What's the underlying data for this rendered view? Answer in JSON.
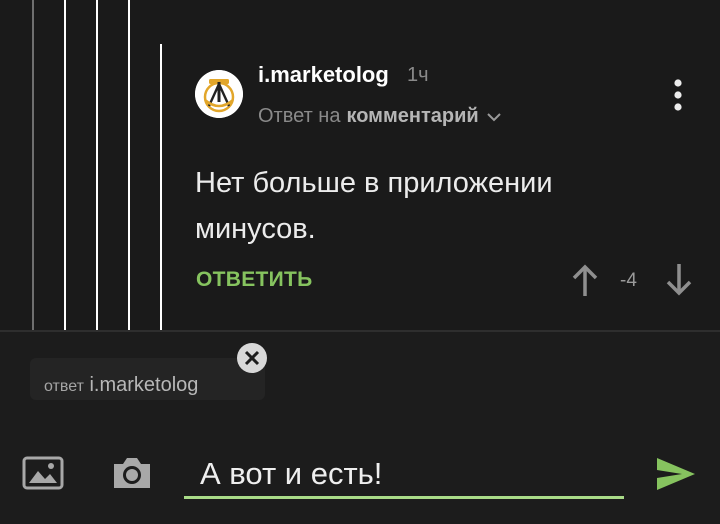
{
  "comment": {
    "username": "i.marketolog",
    "time": "1ч",
    "reply_prefix": "Ответ на",
    "reply_target": "комментарий",
    "text": "Нет больше в приложении минусов.",
    "reply_label": "ОТВЕТИТЬ",
    "score": "-4",
    "avatar_icon": "emblem-hammer-compass-icon",
    "menu_icon": "more-vertical-icon",
    "upvote_icon": "arrow-up-icon",
    "downvote_icon": "arrow-down-icon"
  },
  "reply_bar": {
    "prefix": "ответ",
    "target_user": "i.marketolog",
    "close_icon": "close-icon"
  },
  "composer": {
    "input_value": "А вот и есть!",
    "image_icon": "image-icon",
    "camera_icon": "camera-icon",
    "send_icon": "send-icon"
  },
  "colors": {
    "background": "#1a1a1a",
    "accent_green": "#86c35f",
    "input_underline": "#a9db88",
    "text_primary": "#ececec",
    "text_secondary": "#8a8a8a"
  }
}
